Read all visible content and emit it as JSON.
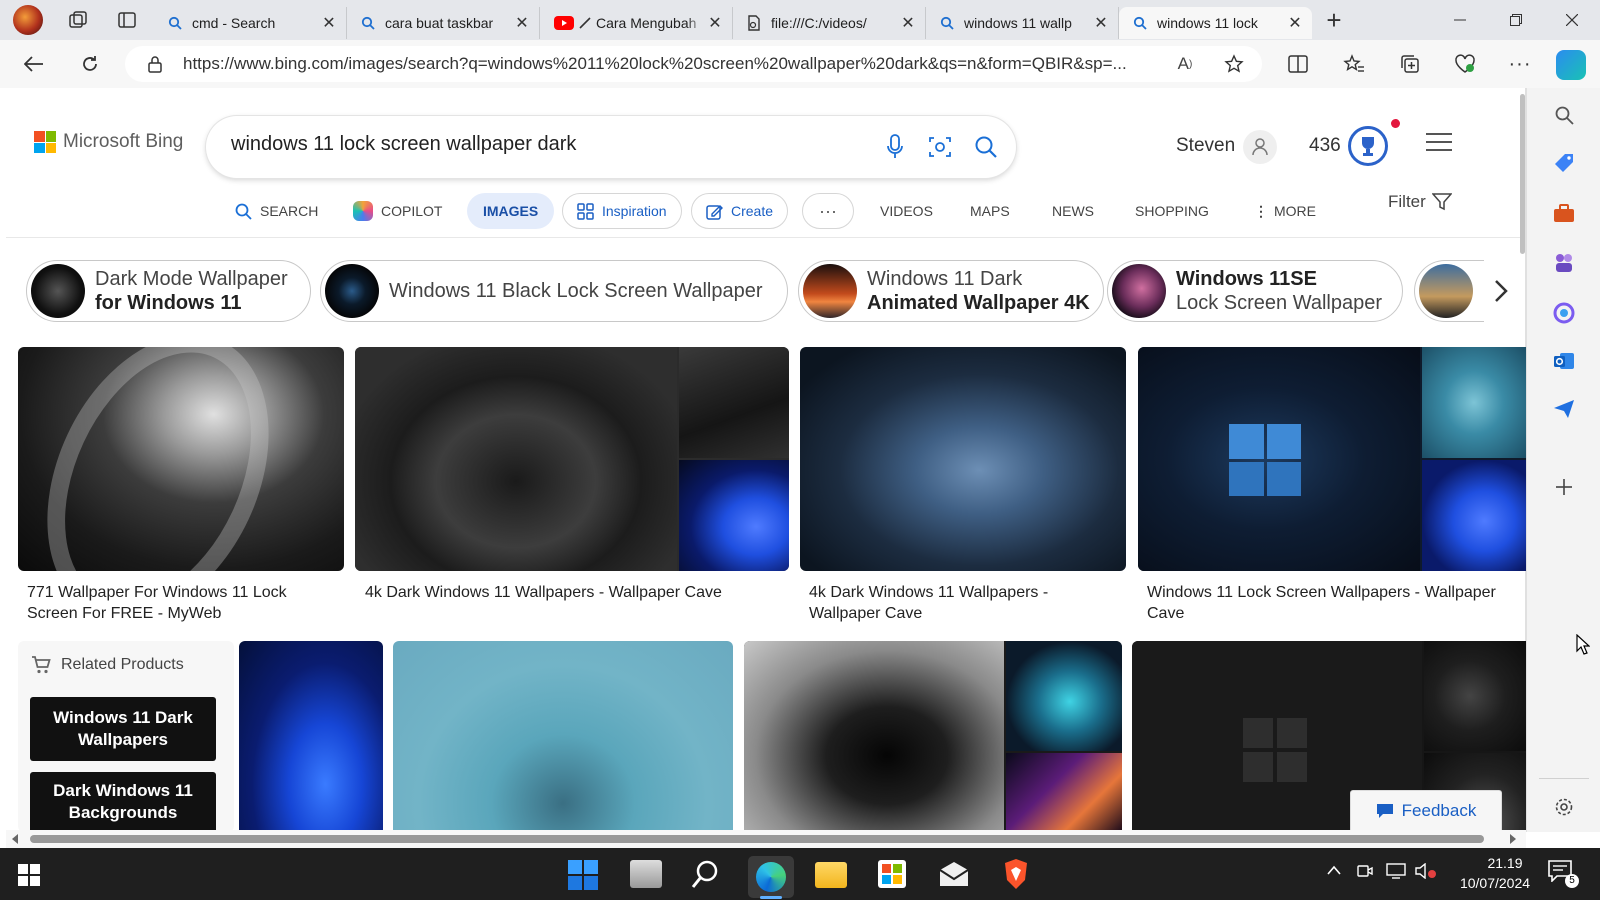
{
  "browser": {
    "tabs": [
      {
        "label": "cmd - Search",
        "icon": "search-icon"
      },
      {
        "label": "cara buat taskbar",
        "icon": "search-icon"
      },
      {
        "label": "Cara Mengubah",
        "icon": "youtube-icon"
      },
      {
        "label": "file:///C:/videos/",
        "icon": "file-icon"
      },
      {
        "label": "windows 11 wallp",
        "icon": "search-icon"
      },
      {
        "label": "windows 11 lock",
        "icon": "search-icon",
        "active": true
      }
    ],
    "url": "https://www.bing.com/images/search?q=windows%2011%20lock%20screen%20wallpaper%20dark&qs=n&form=QBIR&sp=..."
  },
  "bing": {
    "logo": "Microsoft Bing",
    "query": "windows 11 lock screen wallpaper dark",
    "user": "Steven",
    "points": "436",
    "nav": {
      "search": "SEARCH",
      "copilot": "COPILOT",
      "images": "IMAGES",
      "inspiration": "Inspiration",
      "create": "Create",
      "more_dots": "···",
      "videos": "VIDEOS",
      "maps": "MAPS",
      "news": "NEWS",
      "shopping": "SHOPPING",
      "more": "MORE",
      "filter": "Filter"
    },
    "chips": [
      {
        "line1": "Dark Mode Wallpaper",
        "line2": "for Windows 11"
      },
      {
        "line1": "Windows 11 Black Lock Screen Wallpaper",
        "line2": ""
      },
      {
        "line1": "Windows 11 Dark",
        "line2": "Animated Wallpaper 4K"
      },
      {
        "line1": "Windows 11SE",
        "line2": "Lock Screen Wallpaper"
      }
    ],
    "results": [
      {
        "caption": "771 Wallpaper For Windows 11 Lock Screen For FREE - MyWeb"
      },
      {
        "caption": "4k Dark Windows 11 Wallpapers - Wallpaper Cave"
      },
      {
        "caption": "4k Dark Windows 11 Wallpapers - Wallpaper Cave"
      },
      {
        "caption": "Windows 11 Lock Screen Wallpapers - Wallpaper Cave"
      }
    ],
    "related": {
      "title": "Related Products",
      "items": [
        "Windows 11 Dark Wallpapers",
        "Dark Windows 11 Backgrounds"
      ]
    },
    "feedback": "Feedback"
  },
  "taskbar": {
    "time": "21.19",
    "date": "10/07/2024",
    "notification_count": "5"
  }
}
